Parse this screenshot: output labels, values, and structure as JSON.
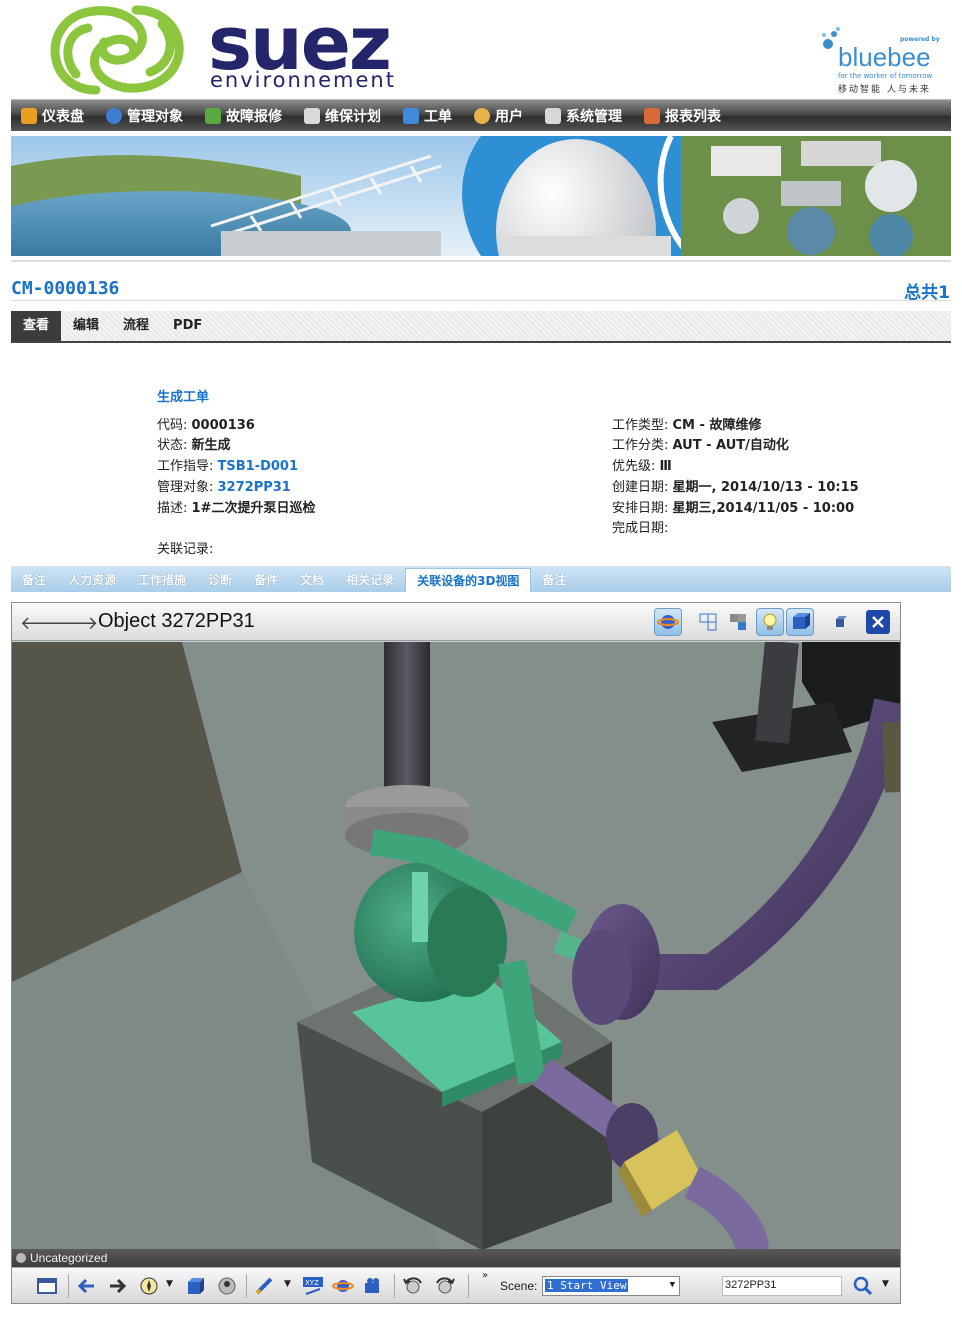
{
  "brand": {
    "name": "suez",
    "subtitle": "environnement",
    "partner_powered": "powered by",
    "partner_name": "bluebee",
    "partner_tagline": "for the worker of tomorrow",
    "partner_cn": "移动智能 人与未来",
    "colors": {
      "suez_green": "#8cc63e",
      "suez_navy": "#24256b",
      "bluebee": "#3b8ed0"
    }
  },
  "nav": {
    "items": [
      {
        "label": "仪表盘",
        "icon": "dashboard-icon",
        "color": "#e8a020"
      },
      {
        "label": "管理对象",
        "icon": "globe-icon",
        "color": "#3d7fd0"
      },
      {
        "label": "故障报修",
        "icon": "wrench-icon",
        "color": "#5aa844"
      },
      {
        "label": "维保计划",
        "icon": "calendar-icon",
        "color": "#d9d9d9"
      },
      {
        "label": "工单",
        "icon": "flag-icon",
        "color": "#3f8ad9"
      },
      {
        "label": "用户",
        "icon": "users-icon",
        "color": "#e6b24a"
      },
      {
        "label": "系统管理",
        "icon": "tools-icon",
        "color": "#d8d8d8"
      },
      {
        "label": "报表列表",
        "icon": "report-icon",
        "color": "#d86a3a"
      }
    ]
  },
  "record": {
    "id": "CM-0000136",
    "total": "总共1"
  },
  "actions": {
    "tabs": [
      "查看",
      "编辑",
      "流程",
      "PDF"
    ],
    "active": 0
  },
  "details": {
    "section_title": "生成工单",
    "left": [
      {
        "label": "代码: ",
        "value": "0000136",
        "link": false
      },
      {
        "label": "状态: ",
        "value": "新生成",
        "link": false
      },
      {
        "label": "工作指导: ",
        "value": "TSB1-D001",
        "link": true
      },
      {
        "label": "管理对象: ",
        "value": "3272PP31",
        "link": true
      },
      {
        "label": "描述: ",
        "value": "1#二次提升泵日巡检",
        "link": false
      }
    ],
    "right": [
      {
        "label": "工作类型: ",
        "value": "CM - 故障维修"
      },
      {
        "label": "工作分类: ",
        "value": "AUT - AUT/自动化"
      },
      {
        "label": "优先级: ",
        "value": "Ⅲ"
      },
      {
        "label": "创建日期: ",
        "value": "星期一, 2014/10/13 - 10:15"
      },
      {
        "label": "安排日期: ",
        "value": "星期三,2014/11/05 - 10:00"
      },
      {
        "label": "完成日期: ",
        "value": ""
      }
    ],
    "related_label": "关联记录:"
  },
  "subtabs": {
    "items": [
      "备注",
      "人力资源",
      "工作措施",
      "诊断",
      "备件",
      "文档",
      "相关记录",
      "关联设备的3D视图",
      "备注"
    ],
    "active": 7
  },
  "viewer": {
    "title": "Object 3272PP31",
    "status": "Uncategorized",
    "scene_label": "Scene:",
    "scene_value": "1 Start View",
    "search_value": "3272PP31",
    "expand_glyph": "»"
  }
}
